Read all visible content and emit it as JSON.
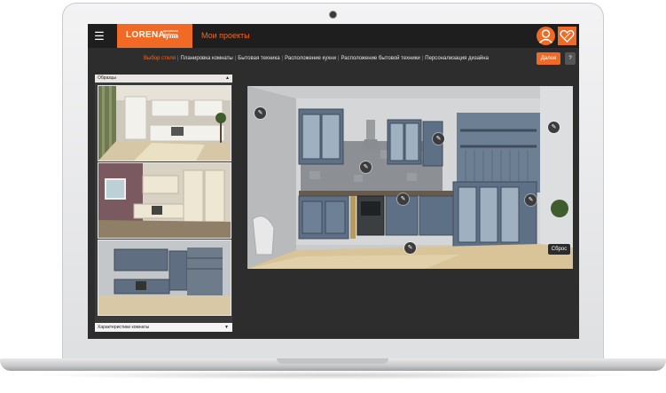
{
  "header": {
    "logo_main": "LORENA",
    "logo_sub": "кухонная фабрика",
    "logo_sub2": "кухни",
    "projects_link": "Мои проекты",
    "menu_icon": "hamburger-icon",
    "user_icon": "user-icon",
    "favorite_icon": "heart-percent-icon"
  },
  "steps": {
    "items": [
      "Выбор стиля",
      "Планировка комнаты",
      "Бытовая техника",
      "Расположение кухни",
      "Расположение бытовой техники",
      "Персонализация дизайна"
    ],
    "active_index": 0,
    "next_label": "Далее",
    "help_label": "?"
  },
  "sidebar": {
    "header_label": "Образцы",
    "footer_label": "Характеристики комнаты",
    "thumbnails": [
      "classic-white-kitchen",
      "cream-kitchen",
      "grey-blue-kitchen"
    ]
  },
  "viewer": {
    "reset_label": "Сброс",
    "edit_icon": "pencil-icon"
  },
  "colors": {
    "accent": "#f06a25",
    "app_bg": "#2d2d2d",
    "topbar": "#1e1e1e"
  }
}
